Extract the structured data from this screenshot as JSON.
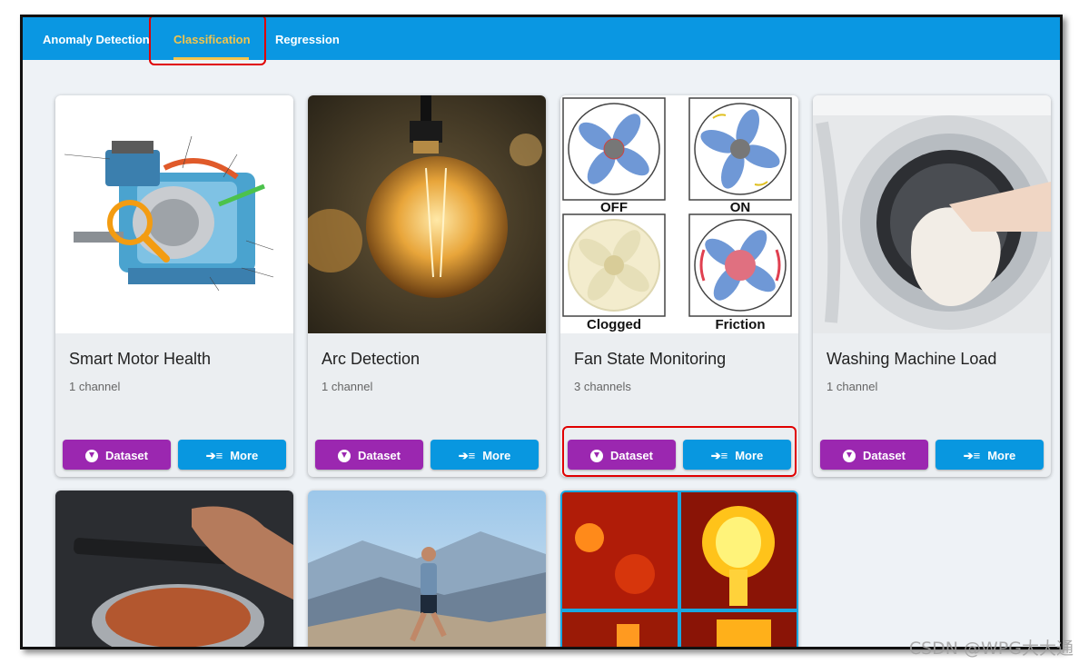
{
  "tabs": [
    {
      "label": "Anomaly Detection"
    },
    {
      "label": "Classification",
      "active": true
    },
    {
      "label": "Regression"
    }
  ],
  "cards": [
    {
      "title": "Smart Motor Health",
      "subtitle": "1 channel"
    },
    {
      "title": "Arc Detection",
      "subtitle": "1 channel"
    },
    {
      "title": "Fan State Monitoring",
      "subtitle": "3 channels"
    },
    {
      "title": "Washing Machine Load",
      "subtitle": "1 channel"
    }
  ],
  "buttons": {
    "dataset": "Dataset",
    "more": "More"
  },
  "fan_image_labels": [
    "OFF",
    "ON",
    "Clogged",
    "Friction"
  ],
  "watermark": "CSDN @WPG大大通",
  "colors": {
    "topbar": "#0a97e2",
    "active_tab": "#f3c44c",
    "dataset_button": "#9b27b0",
    "more_button": "#0897e0",
    "highlight": "#e00000"
  },
  "icons": {
    "dataset": "download-icon",
    "more": "list-arrow-icon"
  }
}
